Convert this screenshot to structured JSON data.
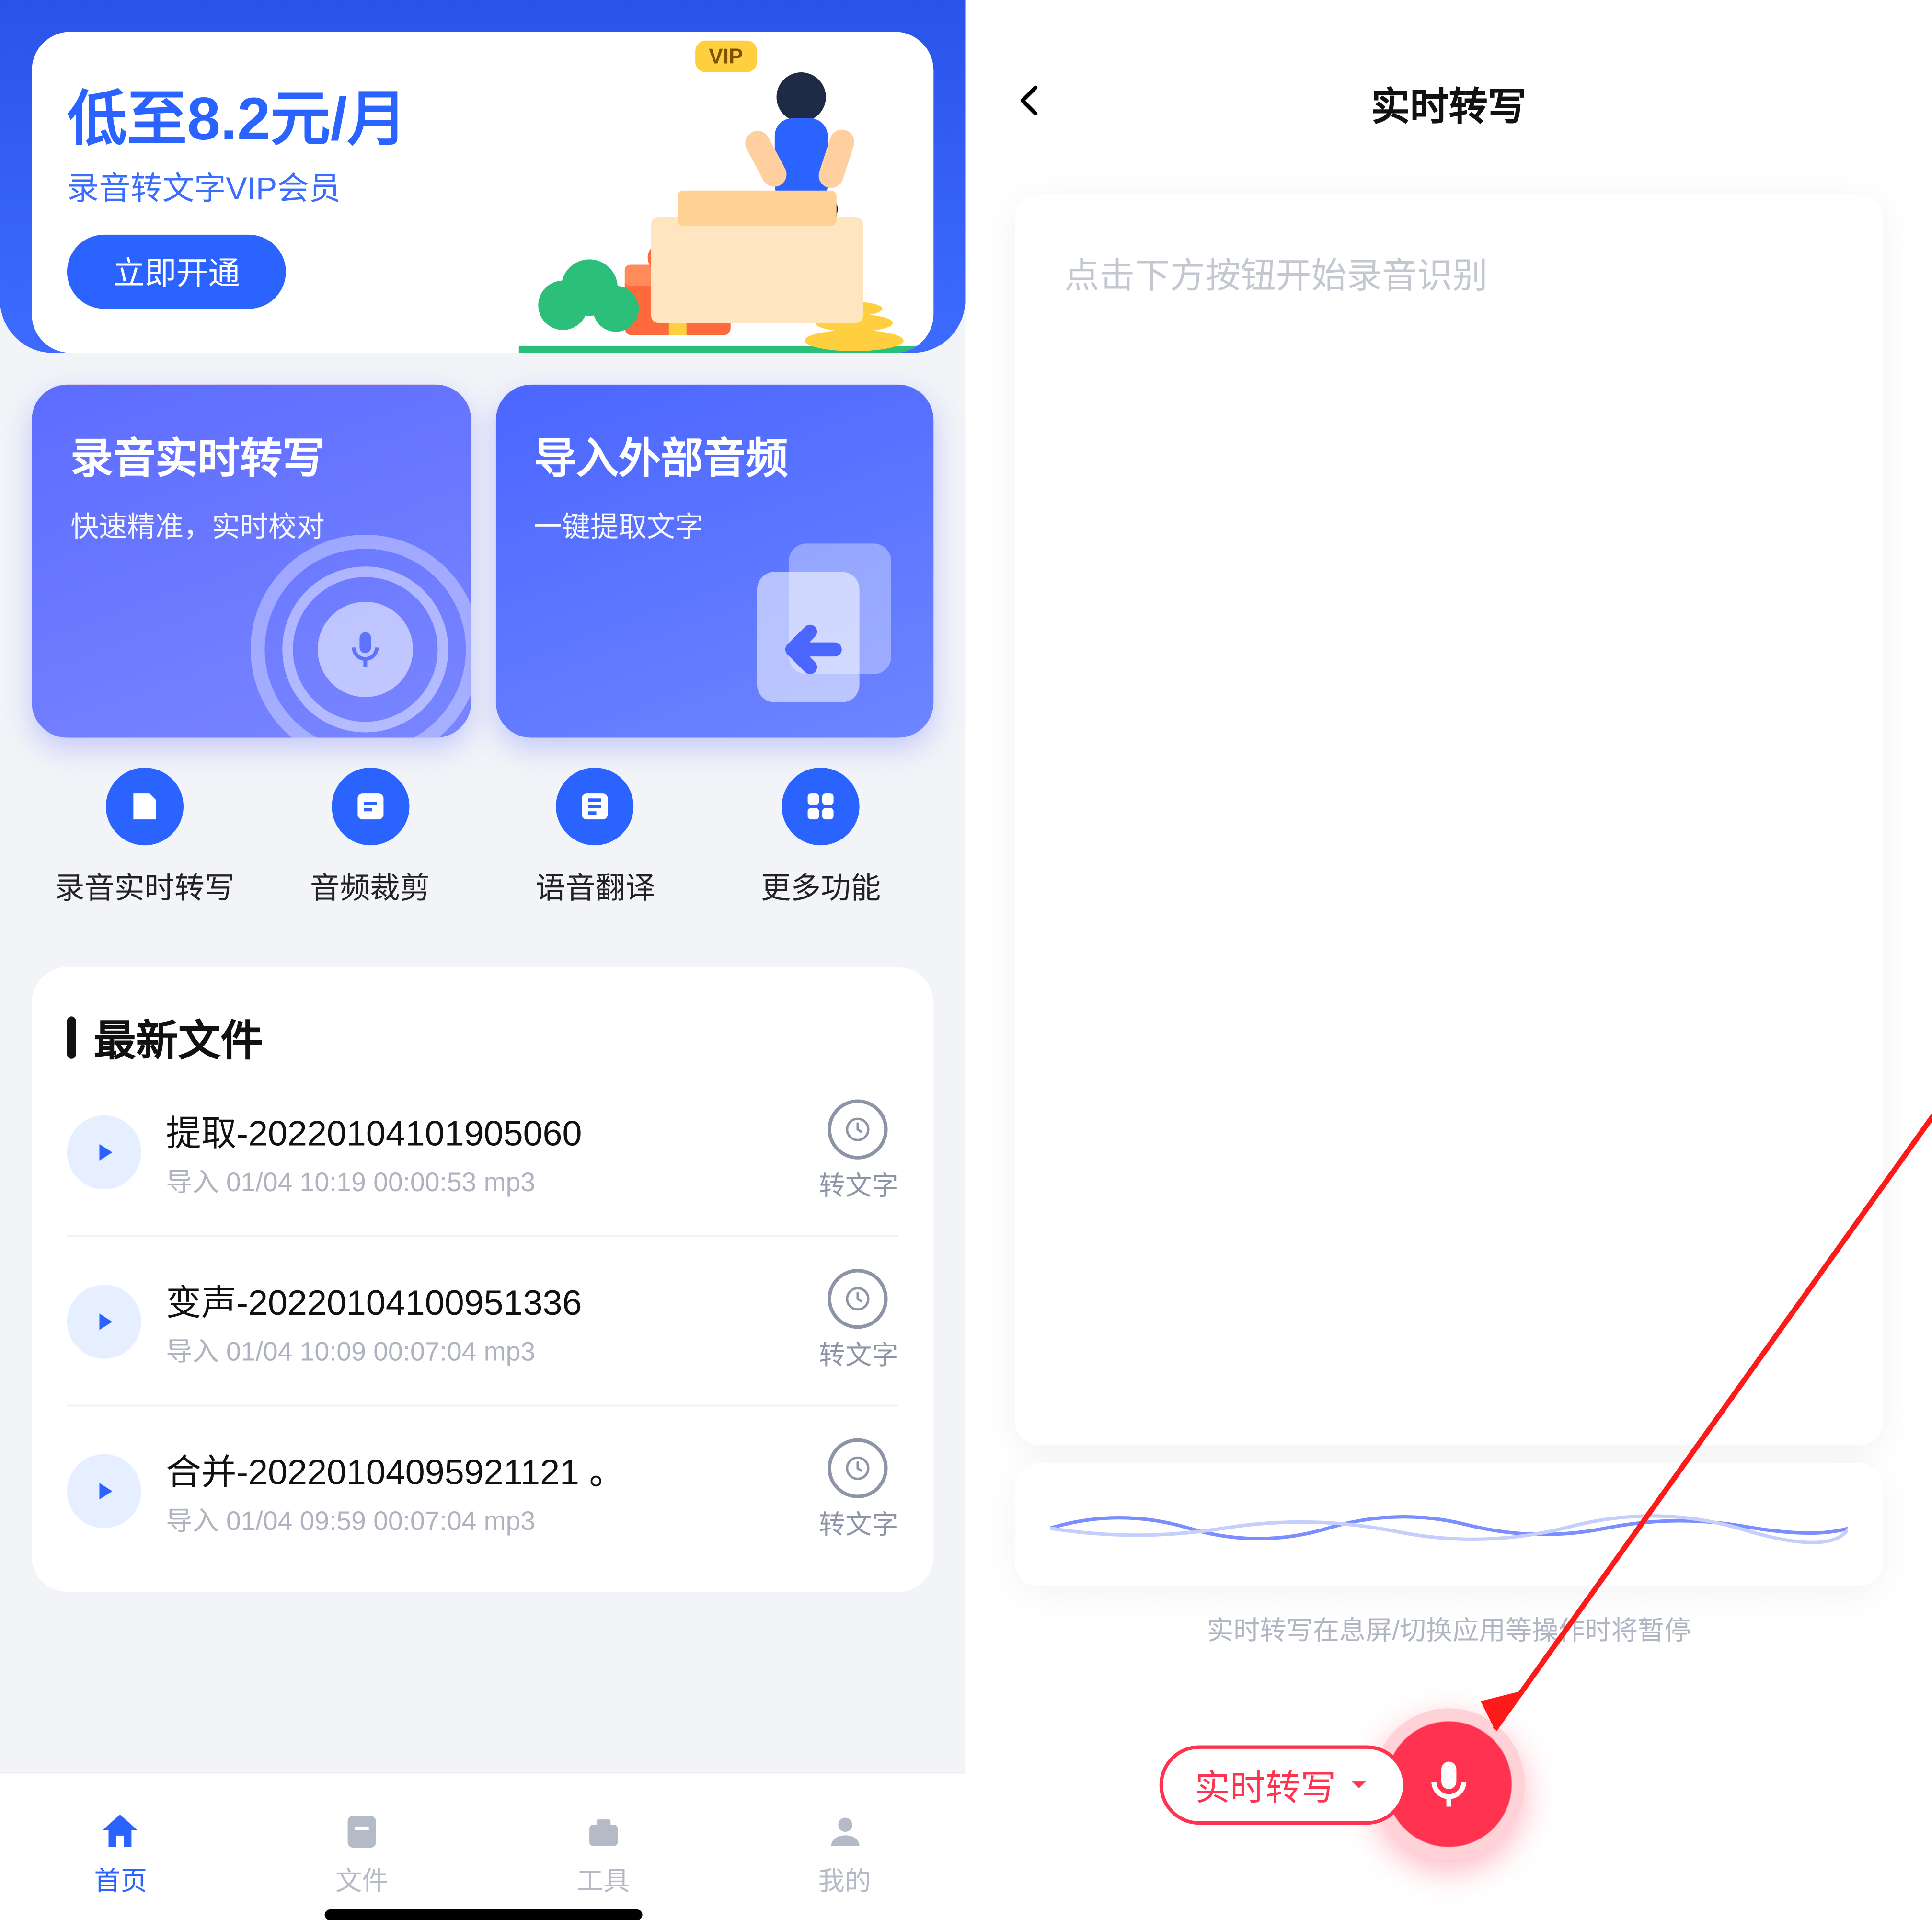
{
  "promo": {
    "title": "低至8.2元/月",
    "subtitle": "录音转文字VIP会员",
    "button": "立即开通",
    "vip_badge": "VIP"
  },
  "cards": {
    "a": {
      "title": "录音实时转写",
      "desc": "快速精准，实时校对"
    },
    "b": {
      "title": "导入外部音频",
      "desc": "一键提取文字"
    }
  },
  "quick": [
    {
      "label": "录音实时转写"
    },
    {
      "label": "音频裁剪"
    },
    {
      "label": "语音翻译"
    },
    {
      "label": "更多功能"
    }
  ],
  "files": {
    "heading": "最新文件",
    "convert_label": "转文字",
    "items": [
      {
        "name": "提取-20220104101905060",
        "meta": "导入 01/04 10:19 00:00:53 mp3"
      },
      {
        "name": "变声-20220104100951336",
        "meta": "导入 01/04 10:09 00:07:04 mp3"
      },
      {
        "name": "合并-20220104095921121 。",
        "meta": "导入 01/04 09:59 00:07:04 mp3"
      }
    ]
  },
  "tabs": [
    {
      "label": "首页"
    },
    {
      "label": "文件"
    },
    {
      "label": "工具"
    },
    {
      "label": "我的"
    }
  ],
  "right": {
    "title": "实时转写",
    "placeholder": "点击下方按钮开始录音识别",
    "hint": "实时转写在息屏/切换应用等操作时将暂停",
    "mode_label": "实时转写"
  }
}
